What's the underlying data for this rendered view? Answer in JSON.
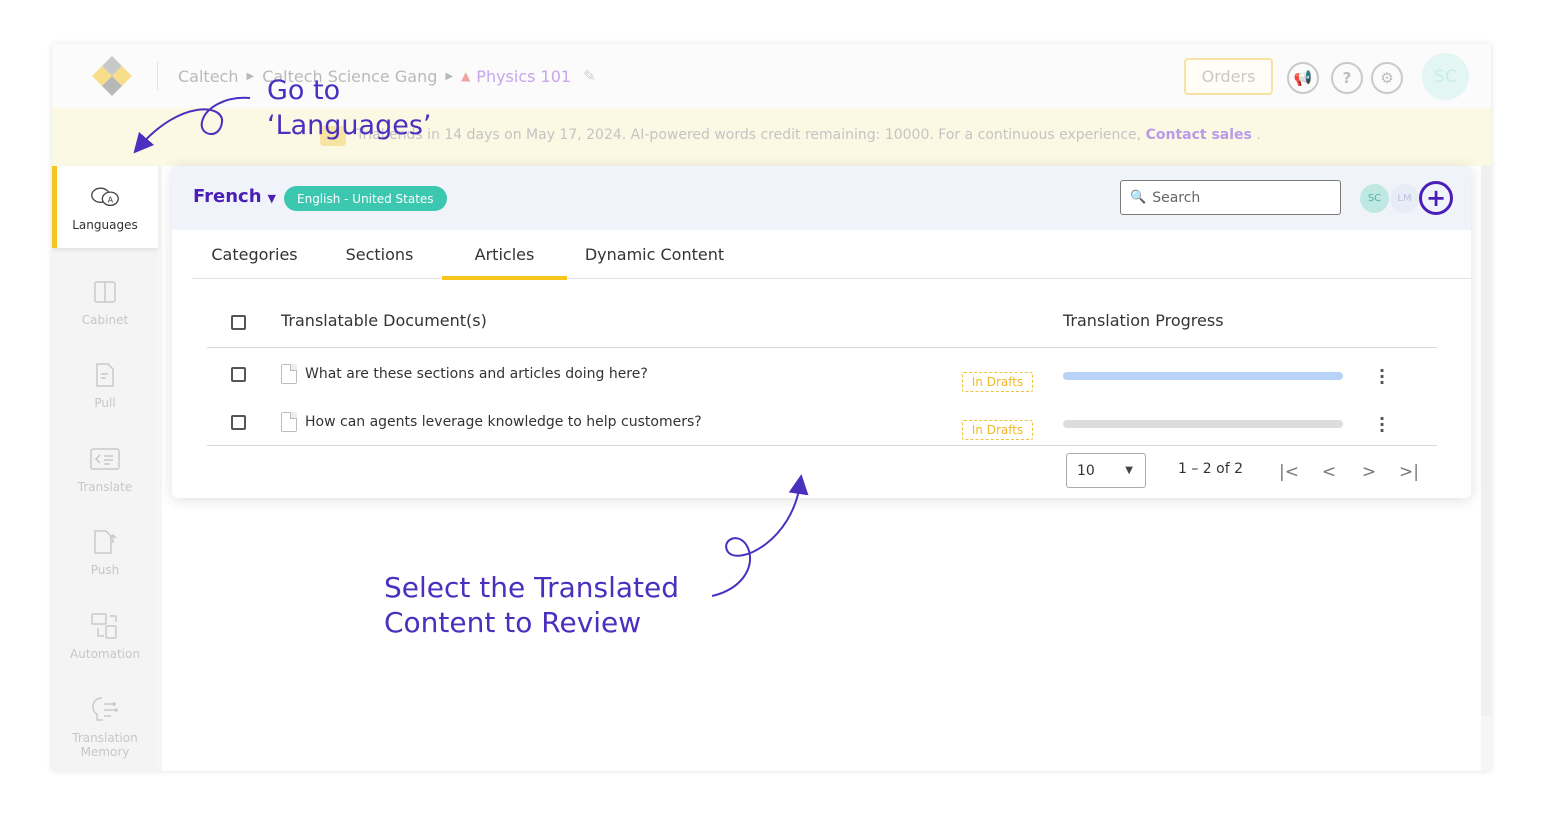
{
  "header": {
    "breadcrumbs": [
      "Caltech",
      "Caltech Science Gang"
    ],
    "current_project": "Physics 101",
    "orders_label": "Orders",
    "avatar_initials": "SC"
  },
  "banner": {
    "text": "Trial ends in 14 days on May 17, 2024. AI-powered words credit remaining: 10000. For a continuous experience,",
    "link": "Contact sales",
    "suffix": "."
  },
  "sidebar": {
    "items": [
      {
        "label": "Languages",
        "icon": "languages-icon",
        "active": true
      },
      {
        "label": "Cabinet",
        "icon": "cabinet-icon",
        "active": false
      },
      {
        "label": "Pull",
        "icon": "pull-icon",
        "active": false
      },
      {
        "label": "Translate",
        "icon": "translate-icon",
        "active": false
      },
      {
        "label": "Push",
        "icon": "push-icon",
        "active": false
      },
      {
        "label": "Automation",
        "icon": "automation-icon",
        "active": false
      },
      {
        "label": "Translation Memory",
        "icon": "translation-memory-icon",
        "active": false
      }
    ]
  },
  "panel": {
    "language": "French",
    "source_language": "English - United States",
    "search_placeholder": "Search",
    "avatars": [
      "SC",
      "LM"
    ],
    "tabs": [
      "Categories",
      "Sections",
      "Articles",
      "Dynamic Content"
    ],
    "active_tab": "Articles",
    "columns": {
      "document": "Translatable Document(s)",
      "progress": "Translation Progress"
    },
    "rows": [
      {
        "title": "What are these sections and articles doing here?",
        "status": "In Drafts",
        "progress": 1.0
      },
      {
        "title": "How can agents leverage knowledge to help customers?",
        "status": "In Drafts",
        "progress": 0.0
      }
    ],
    "pagination": {
      "page_size": "10",
      "range": "1 – 2 of 2"
    }
  },
  "annotations": {
    "languages_line1": "Go to",
    "languages_line2": "‘Languages’",
    "review_line1": "Select the Translated",
    "review_line2": "Content to Review"
  },
  "colors": {
    "accent": "#4b1fb6",
    "active_bar": "#f7c51c",
    "pill": "#3cc7b0",
    "progress_fill": "#b7d3f7",
    "draft_badge": "#f0b92b"
  }
}
